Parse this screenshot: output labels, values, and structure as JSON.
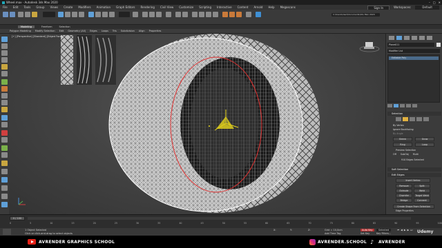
{
  "window": {
    "title": "Wheel.max - Autodesk 3ds Max 2020",
    "controls": [
      "–",
      "□",
      "✕"
    ]
  },
  "menu": {
    "items": [
      "File",
      "Edit",
      "Tools",
      "Group",
      "Views",
      "Create",
      "Modifiers",
      "Animation",
      "Graph Editors",
      "Rendering",
      "Civil View",
      "Customize",
      "Scripting",
      "Interactive",
      "Content",
      "Arnold",
      "Help",
      "Megascans"
    ],
    "sign_in": "Sign In",
    "workspaces_label": "Workspaces:",
    "workspace_value": "Default"
  },
  "toolbar": {
    "path": "C:\\Users\\User\\Documents\\3ds Max 2020"
  },
  "ribbon": {
    "tabs": [
      "Modeling",
      "Freeform",
      "Selection"
    ],
    "active_tab": "Modeling",
    "items": [
      "Polygon Modeling",
      "Modify Selection",
      "Edit",
      "Geometry (All)",
      "Edges",
      "Loops",
      "Tris",
      "Subdivision",
      "Align",
      "Properties"
    ]
  },
  "viewport": {
    "label": "[+] [Perspective] [Standard] [Edged Faces]"
  },
  "panel": {
    "object_name": "Plane011",
    "modifier_list": "Modifier List",
    "stack_item": "Editable Poly",
    "selection": {
      "header": "Selection",
      "by_vertex": "By Vertex",
      "ignore_backfacing": "Ignore Backfacing",
      "by_angle": "By Angle",
      "shrink": "Shrink",
      "grow": "Grow",
      "ring": "Ring",
      "loop": "Loop",
      "preview_label": "Preview Selection",
      "preview_options": [
        "Off",
        "SubObj",
        "Multi"
      ],
      "status": "910 Edges Selected"
    },
    "soft_selection": {
      "header": "Soft Selection"
    },
    "edit_edges": {
      "header": "Edit Edges",
      "insert_vertex": "Insert Vertex",
      "remove": "Remove",
      "split": "Split",
      "extrude": "Extrude",
      "weld": "Weld",
      "chamfer": "Chamfer",
      "target_weld": "Target Weld",
      "bridge": "Bridge",
      "connect": "Connect",
      "create_shape": "Create Shape From Selection",
      "edge_properties": "Edge Properties"
    }
  },
  "timeline": {
    "frame": "0 / 100",
    "ticks": [
      "0",
      "5",
      "10",
      "15",
      "20",
      "25",
      "30",
      "35",
      "40",
      "45",
      "50",
      "55",
      "60",
      "65",
      "70",
      "75",
      "80",
      "85",
      "90",
      "95",
      "100"
    ]
  },
  "status": {
    "selected": "1 Object Selected",
    "hint": "Click or click-and-drag to select objects",
    "x": "X:",
    "y": "Y:",
    "z": "Z:",
    "grid": "Grid = 10,0cm",
    "add_time_tag": "Add Time Tag",
    "auto_key": "Auto Key",
    "selected_label": "Selected",
    "set_key": "Set Key",
    "key_filters": "Key Filters..."
  },
  "brand": {
    "youtube": "AVRENDER GRAPHICS SCHOOL",
    "instagram": "AVRENDER.SCHOOL",
    "tiktok": "AVRENDER",
    "udemy": "Udemy"
  },
  "colors": {
    "accent_blue": "#4a90d9",
    "auto_key_red": "#b03030",
    "selection_red": "#e03030",
    "gizmo_yellow": "#e6d41a"
  }
}
